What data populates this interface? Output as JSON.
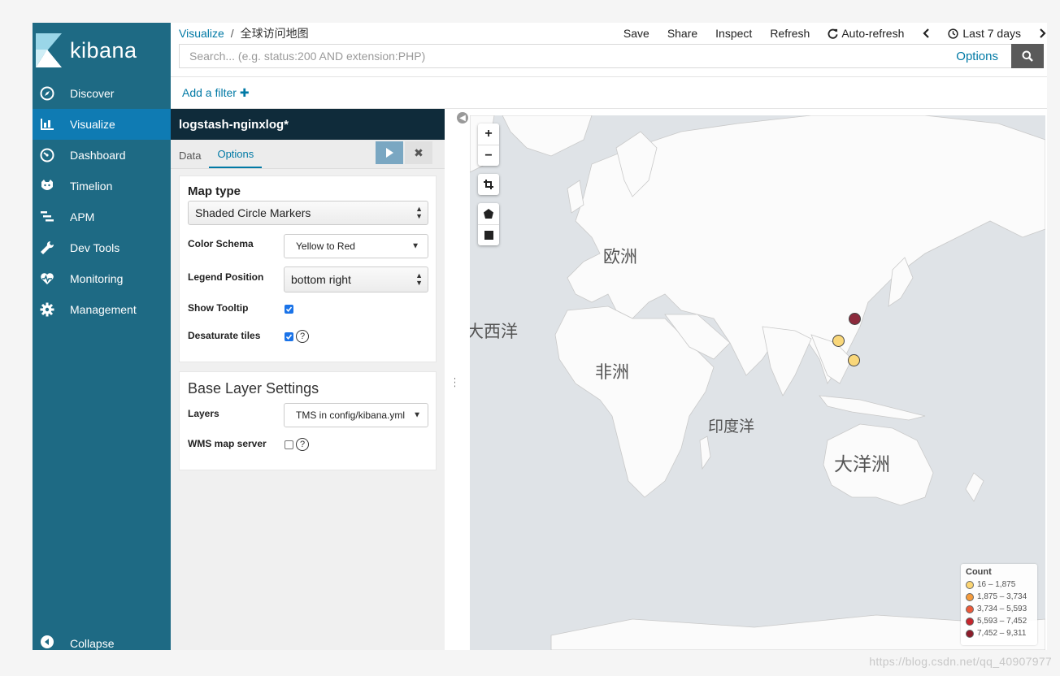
{
  "app": {
    "logo_text": "kibana"
  },
  "sidebar": {
    "items": [
      {
        "label": "Discover",
        "icon": "compass-icon",
        "active": false
      },
      {
        "label": "Visualize",
        "icon": "bar-chart-icon",
        "active": true
      },
      {
        "label": "Dashboard",
        "icon": "dashboard-icon",
        "active": false
      },
      {
        "label": "Timelion",
        "icon": "timelion-icon",
        "active": false
      },
      {
        "label": "APM",
        "icon": "apm-icon",
        "active": false
      },
      {
        "label": "Dev Tools",
        "icon": "wrench-icon",
        "active": false
      },
      {
        "label": "Monitoring",
        "icon": "heartbeat-icon",
        "active": false
      },
      {
        "label": "Management",
        "icon": "gear-icon",
        "active": false
      }
    ],
    "collapse_label": "Collapse"
  },
  "breadcrumb": {
    "root": "Visualize",
    "separator": "/",
    "current": "全球访问地图"
  },
  "top_actions": {
    "save": "Save",
    "share": "Share",
    "inspect": "Inspect",
    "refresh": "Refresh",
    "auto_refresh": "Auto-refresh",
    "time_range": "Last 7 days"
  },
  "search": {
    "placeholder": "Search... (e.g. status:200 AND extension:PHP)",
    "value": "",
    "options_label": "Options"
  },
  "filter": {
    "add_label": "Add a filter"
  },
  "editor": {
    "index_pattern": "logstash-nginxlog*",
    "tabs": [
      {
        "label": "Data",
        "active": false
      },
      {
        "label": "Options",
        "active": true
      }
    ],
    "options": {
      "map_type_title": "Map type",
      "map_type_value": "Shaded Circle Markers",
      "color_schema_label": "Color Schema",
      "color_schema_value": "Yellow to Red",
      "legend_position_label": "Legend Position",
      "legend_position_value": "bottom right",
      "show_tooltip_label": "Show Tooltip",
      "show_tooltip_checked": true,
      "desaturate_label": "Desaturate tiles",
      "desaturate_checked": true
    },
    "base_layer": {
      "title": "Base Layer Settings",
      "layers_label": "Layers",
      "layers_value": "TMS in config/kibana.yml",
      "wms_label": "WMS map server",
      "wms_checked": false
    }
  },
  "map": {
    "labels": {
      "europe": "欧洲",
      "atlantic": "大西洋",
      "africa": "非洲",
      "indian_ocean": "印度洋",
      "oceania": "大洋洲"
    },
    "zoom_in": "+",
    "zoom_out": "−",
    "legend": {
      "title": "Count",
      "ranges": [
        {
          "label": "16 – 1,875",
          "color": "#fcd573"
        },
        {
          "label": "1,875 – 3,734",
          "color": "#f59b3c"
        },
        {
          "label": "3,734 – 5,593",
          "color": "#ec5a3a"
        },
        {
          "label": "5,593 – 7,452",
          "color": "#c6272e"
        },
        {
          "label": "7,452 – 9,311",
          "color": "#8c1c2a"
        }
      ]
    },
    "markers": [
      {
        "name": "east-china",
        "color": "#8c2a3c"
      },
      {
        "name": "south-china",
        "color": "#f9d77a"
      },
      {
        "name": "philippines",
        "color": "#f9d77a"
      }
    ]
  },
  "watermark": "https://blog.csdn.net/qq_40907977"
}
